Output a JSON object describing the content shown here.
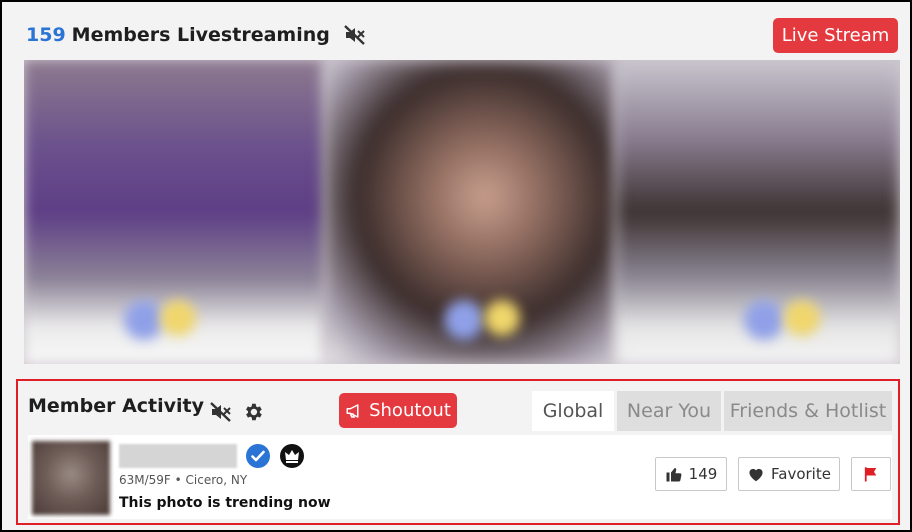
{
  "header": {
    "count": "159",
    "title": "Members Livestreaming",
    "mute_icon": "volume-mute-icon",
    "live_button": "Live Stream"
  },
  "activity": {
    "title": "Member Activity",
    "mute_icon": "volume-mute-icon",
    "settings_icon": "gear-icon",
    "shoutout_label": "Shoutout",
    "tabs": [
      {
        "label": "Global",
        "active": true
      },
      {
        "label": "Near You",
        "active": false
      },
      {
        "label": "Friends & Hotlist",
        "active": false
      }
    ],
    "item": {
      "meta": "63M/59F • Cicero, NY",
      "status": "This photo is trending now",
      "like_count": "149",
      "favorite_label": "Favorite"
    }
  },
  "colors": {
    "accent_red": "#e4393e",
    "count_blue": "#2a74d6",
    "panel_border": "#e01e26"
  }
}
